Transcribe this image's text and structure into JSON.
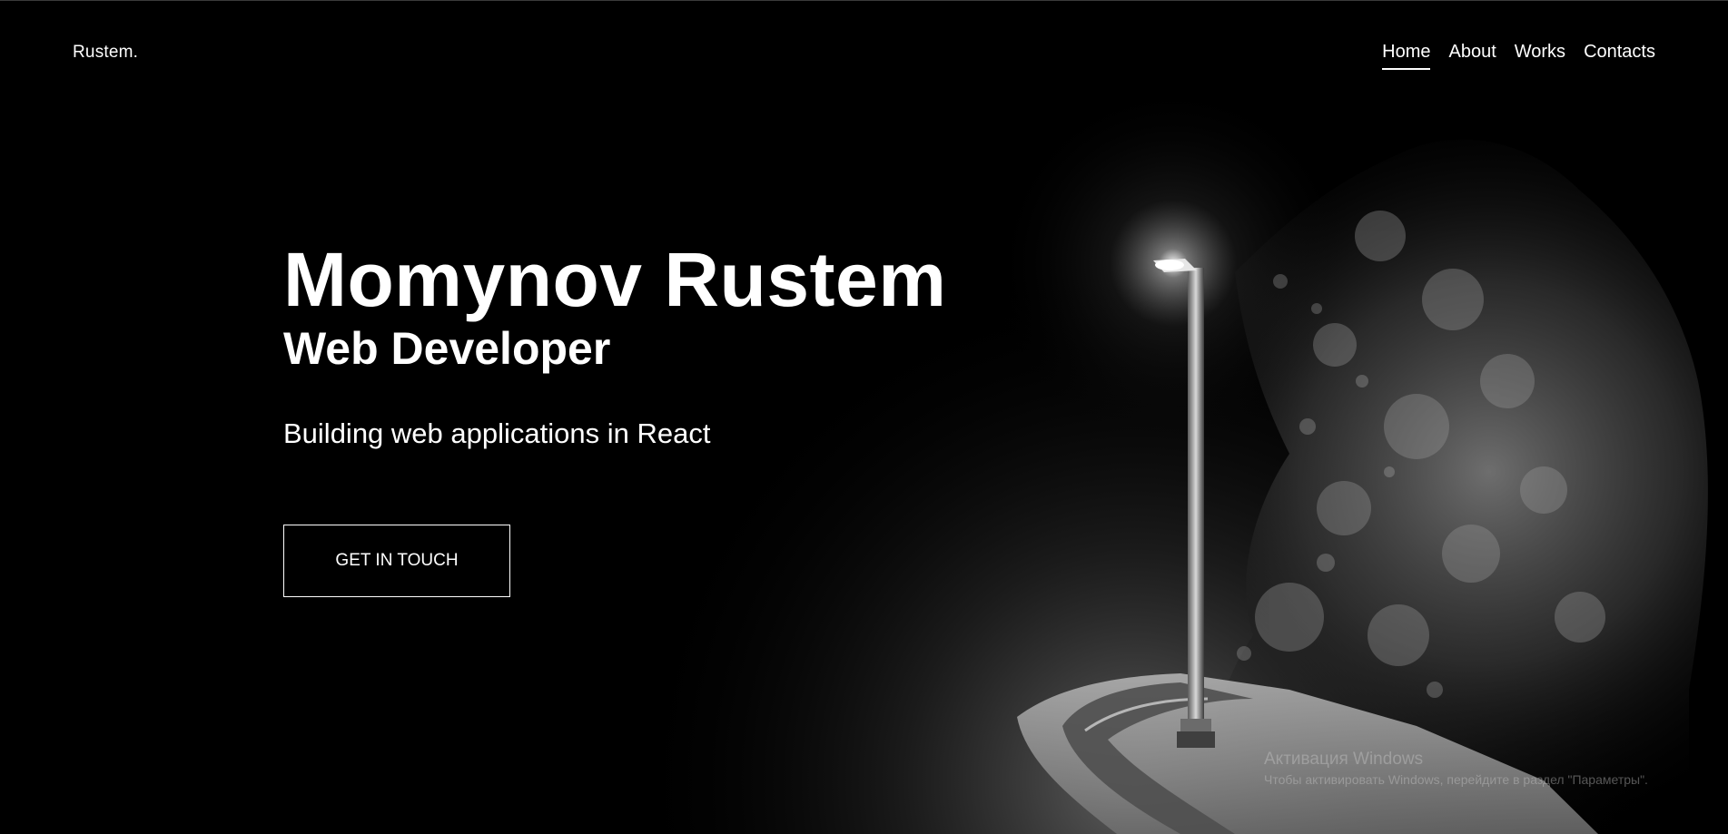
{
  "header": {
    "brand": "Rustem.",
    "nav": [
      {
        "label": "Home",
        "active": true
      },
      {
        "label": "About",
        "active": false
      },
      {
        "label": "Works",
        "active": false
      },
      {
        "label": "Contacts",
        "active": false
      }
    ]
  },
  "hero": {
    "name": "Momynov Rustem",
    "role": "Web Developer",
    "tagline": "Building web applications in React",
    "cta_label": "GET IN TOUCH"
  },
  "watermark": {
    "title": "Активация Windows",
    "subtitle": "Чтобы активировать Windows, перейдите в раздел \"Параметры\"."
  },
  "colors": {
    "background": "#000000",
    "text": "#ffffff"
  }
}
